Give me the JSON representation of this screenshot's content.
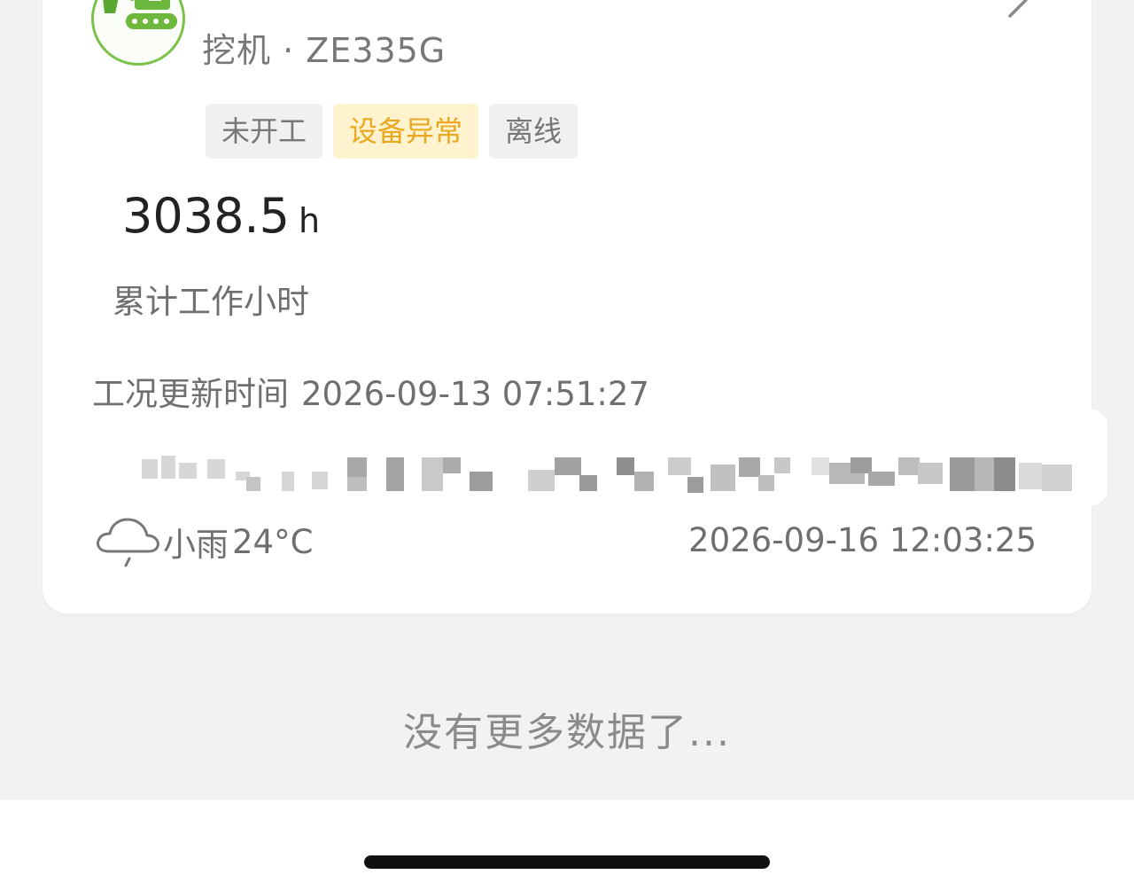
{
  "device": {
    "icon": "excavator-icon",
    "model": "挖机 · ZE335G",
    "tags": [
      {
        "label": "未开工",
        "color": "#777777"
      },
      {
        "label": "设备异常",
        "color": "#e8a820"
      },
      {
        "label": "离线",
        "color": "#777777"
      }
    ],
    "hours_value": "3038.5",
    "hours_unit": "h",
    "hours_label": "累计工作小时",
    "update_label": "工况更新时间",
    "update_time": "2026-09-13 07:51:27"
  },
  "weather": {
    "icon": "cloud-rain-icon",
    "condition": "小雨",
    "temperature": "24°C"
  },
  "timestamp": "2026-09-16 12:03:25",
  "footer_text": "没有更多数据了...",
  "colors": {
    "accent_green": "#7cc24a",
    "warning_yellow": "#e8a820",
    "warning_bg": "#fff3cf"
  }
}
